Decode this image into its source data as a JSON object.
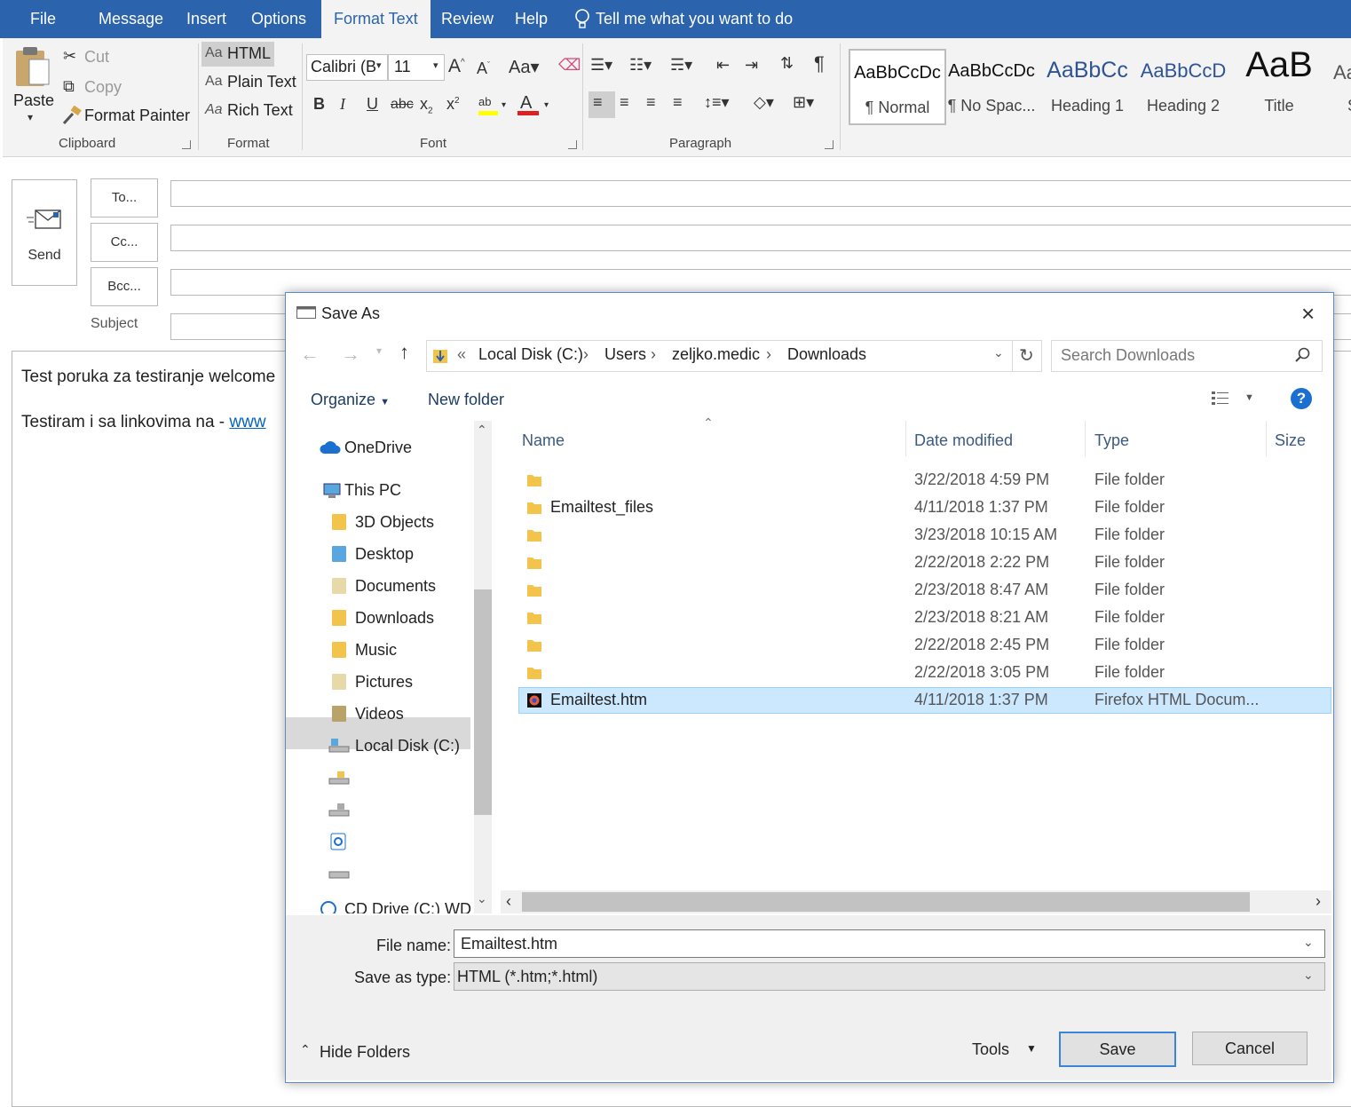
{
  "menu": {
    "tabs": [
      "File",
      "Message",
      "Insert",
      "Options",
      "Format Text",
      "Review",
      "Help"
    ],
    "active": "Format Text",
    "tell_me": "Tell me what you want to do"
  },
  "ribbon": {
    "clipboard": {
      "paste": "Paste",
      "cut": "Cut",
      "copy": "Copy",
      "format_painter": "Format Painter",
      "label": "Clipboard"
    },
    "format": {
      "html": "HTML",
      "plain": "Plain Text",
      "rich": "Rich Text",
      "label": "Format",
      "html_prefix": "Aa",
      "plain_prefix": "Aa",
      "rich_prefix": "Aa"
    },
    "font": {
      "name": "Calibri (B",
      "size": "11",
      "label": "Font"
    },
    "paragraph": {
      "label": "Paragraph"
    },
    "styles": [
      {
        "preview": "AaBbCcDc",
        "name": "¶ Normal"
      },
      {
        "preview": "AaBbCcDc",
        "name": "¶ No Spac..."
      },
      {
        "preview": "AaBbCc",
        "name": "Heading 1"
      },
      {
        "preview": "AaBbCcD",
        "name": "Heading 2"
      },
      {
        "preview": "AaB",
        "name": "Title"
      },
      {
        "preview": "Aa",
        "name": "S"
      }
    ]
  },
  "compose": {
    "send": "Send",
    "to": "To...",
    "cc": "Cc...",
    "bcc": "Bcc...",
    "subject": "Subject",
    "body_line1": "Test poruka za testiranje welcome",
    "body_line2_prefix": "Testiram i sa linkovima na - ",
    "body_line2_link": "www"
  },
  "dialog": {
    "title": "Save As",
    "breadcrumb": [
      "«",
      "Local Disk (C:)",
      "Users",
      "zeljko.medic",
      "Downloads"
    ],
    "search_placeholder": "Search Downloads",
    "organize": "Organize",
    "new_folder": "New folder",
    "nav": [
      {
        "label": "OneDrive",
        "icon": "cloud-icon"
      },
      {
        "label": "This PC",
        "icon": "computer-icon"
      },
      {
        "label": "3D Objects",
        "icon": "folder-3d-icon"
      },
      {
        "label": "Desktop",
        "icon": "desktop-folder-icon"
      },
      {
        "label": "Documents",
        "icon": "documents-folder-icon"
      },
      {
        "label": "Downloads",
        "icon": "downloads-folder-icon"
      },
      {
        "label": "Music",
        "icon": "music-folder-icon"
      },
      {
        "label": "Pictures",
        "icon": "pictures-folder-icon"
      },
      {
        "label": "Videos",
        "icon": "videos-folder-icon"
      },
      {
        "label": "Local Disk (C:)",
        "icon": "drive-icon"
      },
      {
        "label": "",
        "icon": "drive-icon"
      },
      {
        "label": "",
        "icon": "drive-icon"
      },
      {
        "label": "",
        "icon": "network-drive-icon"
      },
      {
        "label": "",
        "icon": "drive-icon"
      },
      {
        "label": "CD Drive (C:) WD",
        "icon": "cd-drive-icon"
      }
    ],
    "columns": {
      "name": "Name",
      "date": "Date modified",
      "type": "Type",
      "size": "Size"
    },
    "files": [
      {
        "name": "",
        "date": "3/22/2018 4:59 PM",
        "type": "File folder",
        "kind": "folder"
      },
      {
        "name": "Emailtest_files",
        "date": "4/11/2018 1:37 PM",
        "type": "File folder",
        "kind": "folder"
      },
      {
        "name": "",
        "date": "3/23/2018 10:15 AM",
        "type": "File folder",
        "kind": "folder"
      },
      {
        "name": "",
        "date": "2/22/2018 2:22 PM",
        "type": "File folder",
        "kind": "folder"
      },
      {
        "name": "",
        "date": "2/23/2018 8:47 AM",
        "type": "File folder",
        "kind": "folder"
      },
      {
        "name": "",
        "date": "2/23/2018 8:21 AM",
        "type": "File folder",
        "kind": "folder"
      },
      {
        "name": "",
        "date": "2/22/2018 2:45 PM",
        "type": "File folder",
        "kind": "folder"
      },
      {
        "name": "",
        "date": "2/22/2018 3:05 PM",
        "type": "File folder",
        "kind": "folder"
      },
      {
        "name": "Emailtest.htm",
        "date": "4/11/2018 1:37 PM",
        "type": "Firefox HTML Docum...",
        "kind": "htm"
      }
    ],
    "selected_index": 8,
    "file_name_label": "File name:",
    "file_name_value": "Emailtest.htm",
    "save_type_label": "Save as type:",
    "save_type_value": "HTML (*.htm;*.html)",
    "hide_folders": "Hide Folders",
    "tools": "Tools",
    "save": "Save",
    "cancel": "Cancel"
  },
  "colors": {
    "menubar": "#2b63ac",
    "selection": "#cce8ff",
    "link": "#0563c1"
  }
}
